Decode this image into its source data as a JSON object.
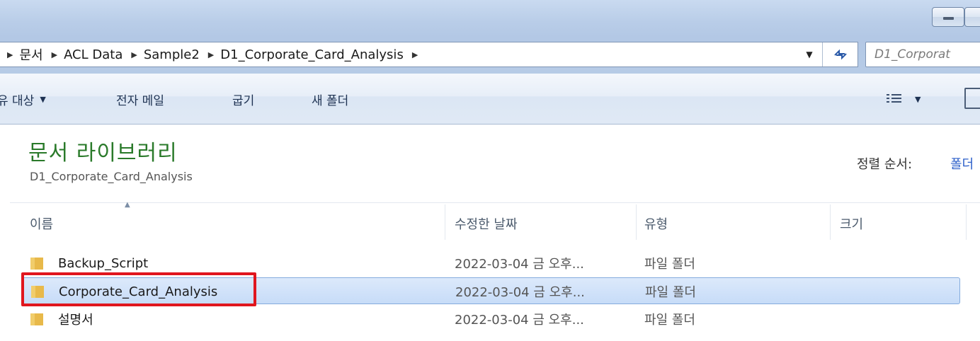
{
  "address_bar": {
    "breadcrumbs": [
      {
        "label": "문서"
      },
      {
        "label": "ACL Data"
      },
      {
        "label": "Sample2"
      },
      {
        "label": "D1_Corporate_Card_Analysis"
      }
    ],
    "search_placeholder": "D1_Corporat"
  },
  "toolbar": {
    "share_label": "유 대상",
    "email_label": "전자 메일",
    "burn_label": "굽기",
    "new_folder_label": "새 폴더"
  },
  "library": {
    "title": "문서 라이브러리",
    "subtitle": "D1_Corporate_Card_Analysis",
    "sort_label": "정렬 순서:",
    "sort_value": "폴더"
  },
  "columns": {
    "name": "이름",
    "date": "수정한 날짜",
    "type": "유형",
    "size": "크기"
  },
  "files": [
    {
      "name": "Backup_Script",
      "date": "2022-03-04 금 오후...",
      "type": "파일 폴더",
      "selected": false
    },
    {
      "name": "Corporate_Card_Analysis",
      "date": "2022-03-04 금 오후...",
      "type": "파일 폴더",
      "selected": true
    },
    {
      "name": "설명서",
      "date": "2022-03-04 금 오후...",
      "type": "파일 폴더",
      "selected": false
    }
  ],
  "colors": {
    "library_title": "#2a7a2a",
    "sort_value": "#2a5ec9",
    "highlight": "#e0161e",
    "selection": "#c7dcf8"
  }
}
